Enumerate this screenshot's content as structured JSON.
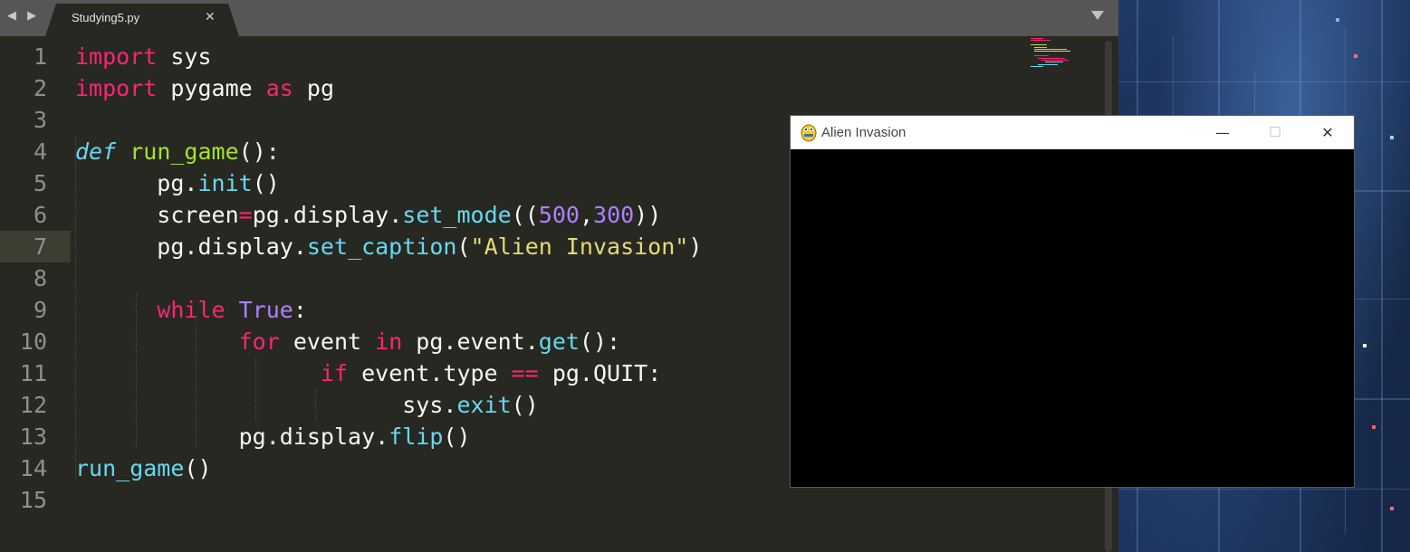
{
  "editor": {
    "nav_arrows": "◀ ▶",
    "tab": {
      "label": "Studying5.py",
      "close": "✕"
    },
    "line_numbers": [
      "1",
      "2",
      "3",
      "4",
      "5",
      "6",
      "7",
      "8",
      "9",
      "10",
      "11",
      "12",
      "13",
      "14",
      "15"
    ],
    "active_line": 6,
    "code_lines": [
      [
        [
          "kw",
          "import"
        ],
        [
          "t",
          " sys"
        ]
      ],
      [
        [
          "kw",
          "import"
        ],
        [
          "t",
          " pygame "
        ],
        [
          "kw",
          "as"
        ],
        [
          "t",
          " pg"
        ]
      ],
      [],
      [
        [
          "df",
          "def"
        ],
        [
          "t",
          " "
        ],
        [
          "fn",
          "run_game"
        ],
        [
          "t",
          "():"
        ]
      ],
      [
        [
          "t",
          "      pg."
        ],
        [
          "cyan",
          "init"
        ],
        [
          "t",
          "()"
        ]
      ],
      [
        [
          "t",
          "      screen"
        ],
        [
          "kw",
          "="
        ],
        [
          "t",
          "pg.display."
        ],
        [
          "cyan",
          "set_mode"
        ],
        [
          "t",
          "(("
        ],
        [
          "num",
          "500"
        ],
        [
          "t",
          ","
        ],
        [
          "num",
          "300"
        ],
        [
          "t",
          "))"
        ]
      ],
      [
        [
          "t",
          "      pg.display."
        ],
        [
          "cyan",
          "set_caption"
        ],
        [
          "t",
          "("
        ],
        [
          "str",
          "\"Alien Invasion\""
        ],
        [
          "t",
          ")"
        ]
      ],
      [],
      [
        [
          "t",
          "      "
        ],
        [
          "kw",
          "while"
        ],
        [
          "t",
          " "
        ],
        [
          "num",
          "True"
        ],
        [
          "t",
          ":"
        ]
      ],
      [
        [
          "t",
          "            "
        ],
        [
          "kw",
          "for"
        ],
        [
          "t",
          " event "
        ],
        [
          "kw",
          "in"
        ],
        [
          "t",
          " pg.event."
        ],
        [
          "cyan",
          "get"
        ],
        [
          "t",
          "():"
        ]
      ],
      [
        [
          "t",
          "                  "
        ],
        [
          "kw",
          "if"
        ],
        [
          "t",
          " event.type "
        ],
        [
          "kw",
          "=="
        ],
        [
          "t",
          " pg.QUIT:"
        ]
      ],
      [
        [
          "t",
          "                        sys."
        ],
        [
          "cyan",
          "exit"
        ],
        [
          "t",
          "()"
        ]
      ],
      [
        [
          "t",
          "            pg.display."
        ],
        [
          "cyan",
          "flip"
        ],
        [
          "t",
          "()"
        ]
      ],
      [
        [
          "cyan",
          "run_game"
        ],
        [
          "t",
          "()"
        ]
      ],
      []
    ],
    "colors": {
      "background": "#272822",
      "keyword": "#f92672",
      "function": "#a6e22e",
      "builtin": "#66d9ef",
      "number": "#ae81ff",
      "string": "#e6db74",
      "text": "#f8f8f2",
      "line_number": "#8f908a"
    }
  },
  "game_window": {
    "title": "Alien Invasion",
    "minimize": "—",
    "maximize": "☐",
    "close": "✕",
    "icon": "pygame-snake-icon",
    "canvas_color": "#000000"
  }
}
